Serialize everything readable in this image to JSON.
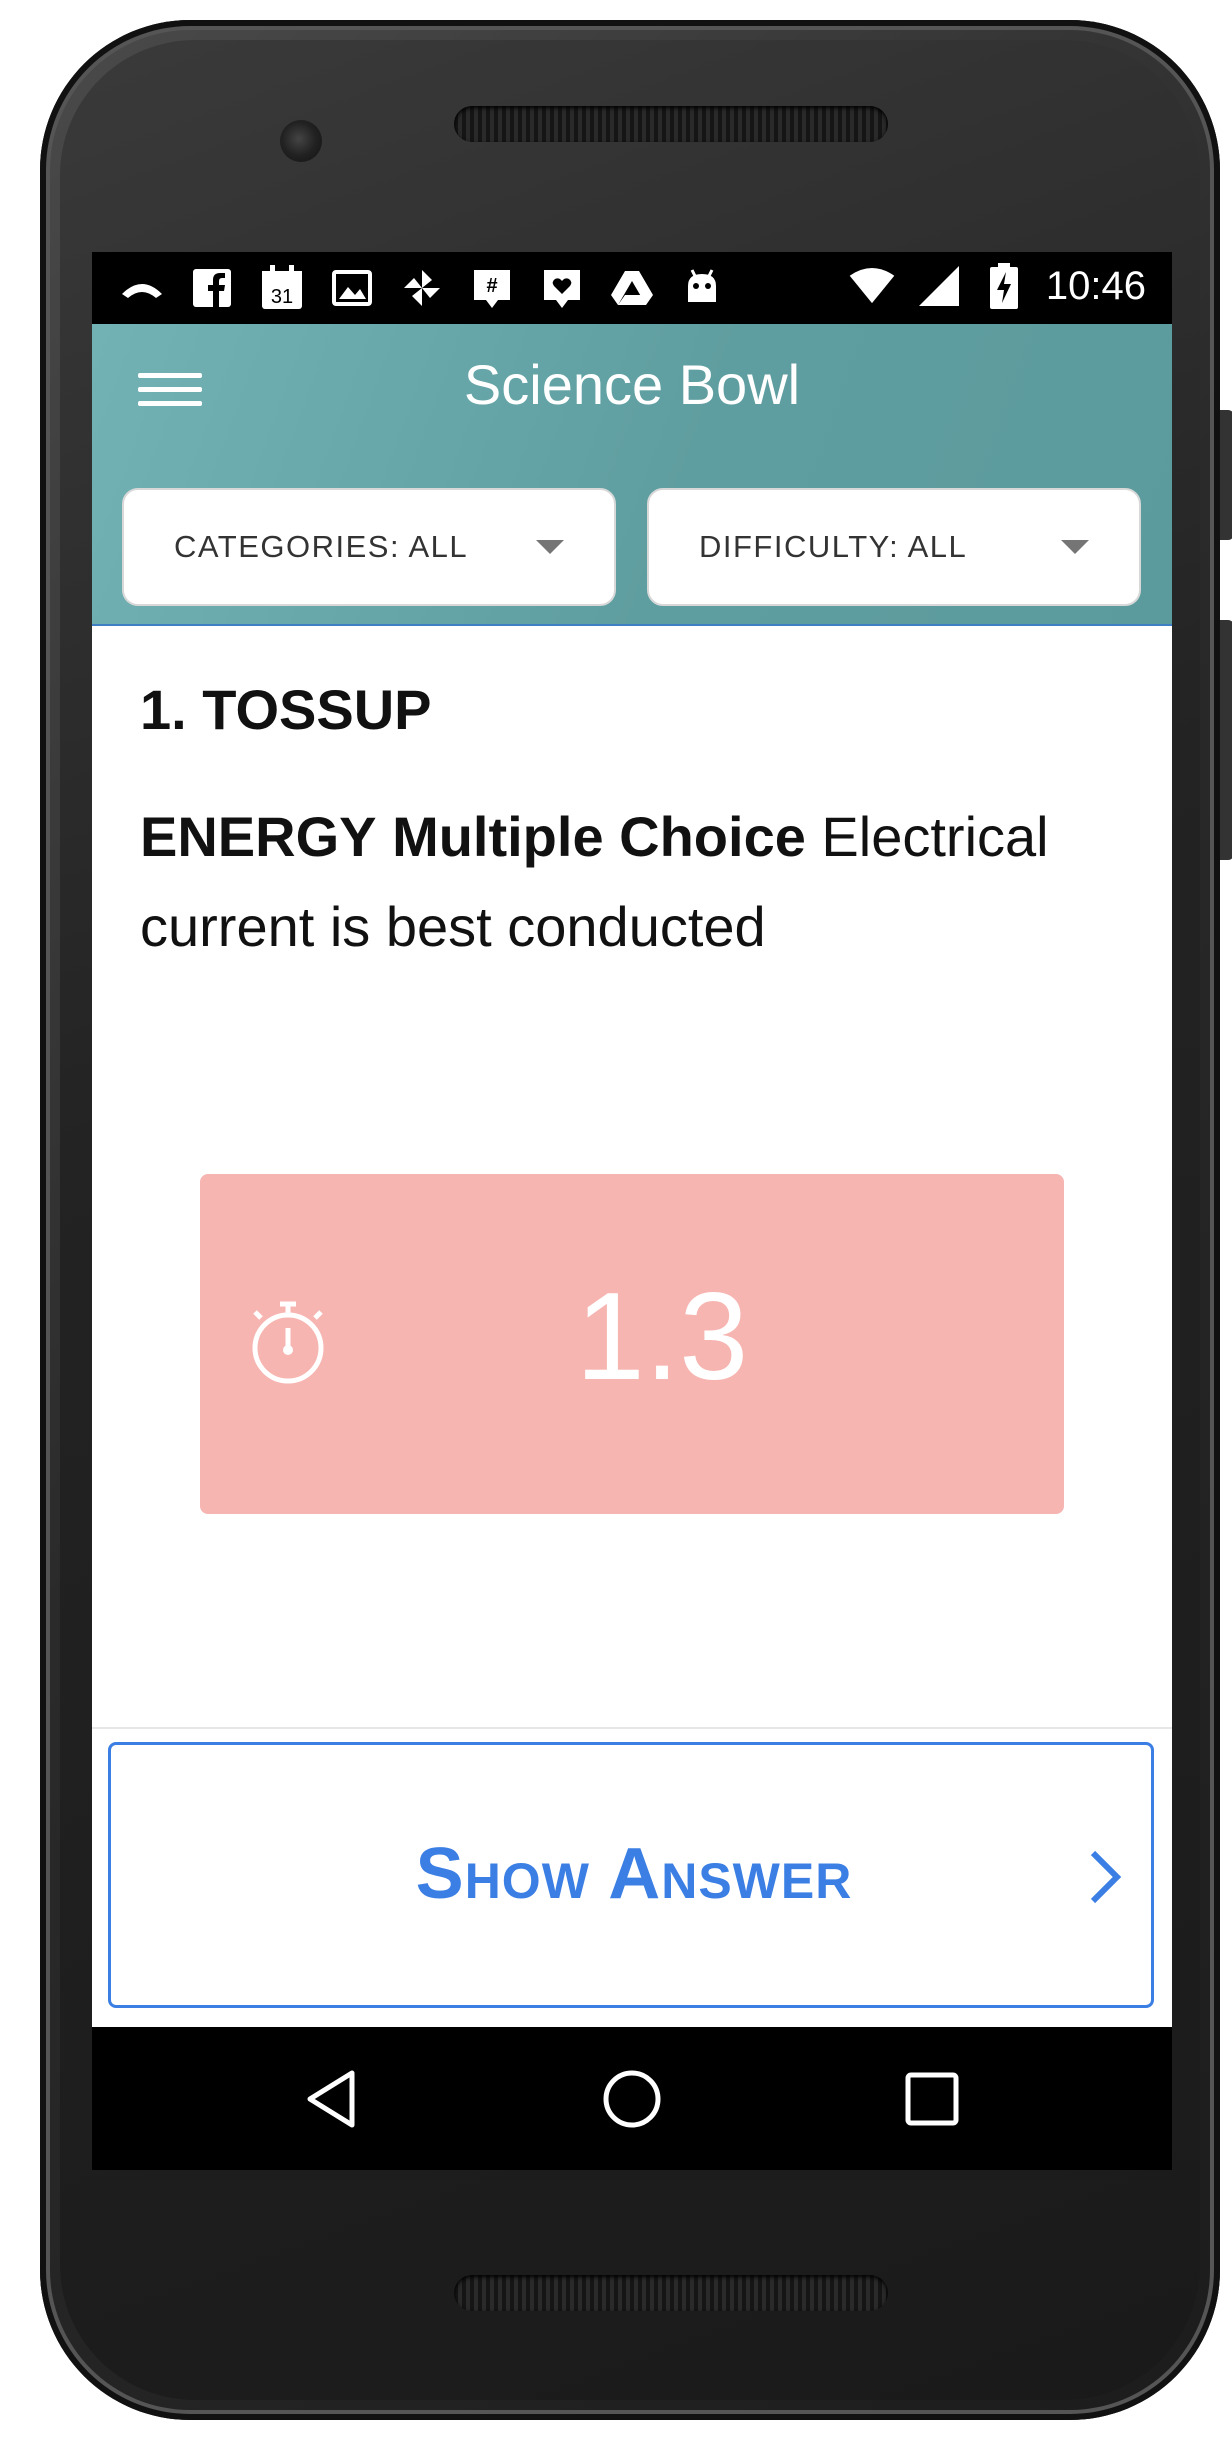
{
  "status_bar": {
    "time": "10:46",
    "left_icons": [
      "missed-call-icon",
      "facebook-icon",
      "calendar-icon",
      "gallery-icon",
      "pinwheel-icon",
      "groupme-icon",
      "heart-message-icon",
      "drive-icon",
      "android-icon"
    ],
    "calendar_day": "31",
    "right_icons": [
      "wifi-icon",
      "cell-signal-icon",
      "battery-charging-icon"
    ]
  },
  "app_bar": {
    "title": "Science Bowl",
    "categories_label": "CATEGORIES: ALL",
    "difficulty_label": "DIFFICULTY: ALL"
  },
  "question": {
    "header": "1. TOSSUP",
    "category": "ENERGY",
    "type": "Multiple Choice",
    "text": "Electrical current is best conducted"
  },
  "timer": {
    "value": "1.3",
    "color": "#f7b5b1"
  },
  "action": {
    "show_answer_label": "Show Answer",
    "accent_color": "#3b7fe4"
  },
  "nav": {
    "icons": [
      "back-icon",
      "home-icon",
      "recents-icon"
    ]
  }
}
